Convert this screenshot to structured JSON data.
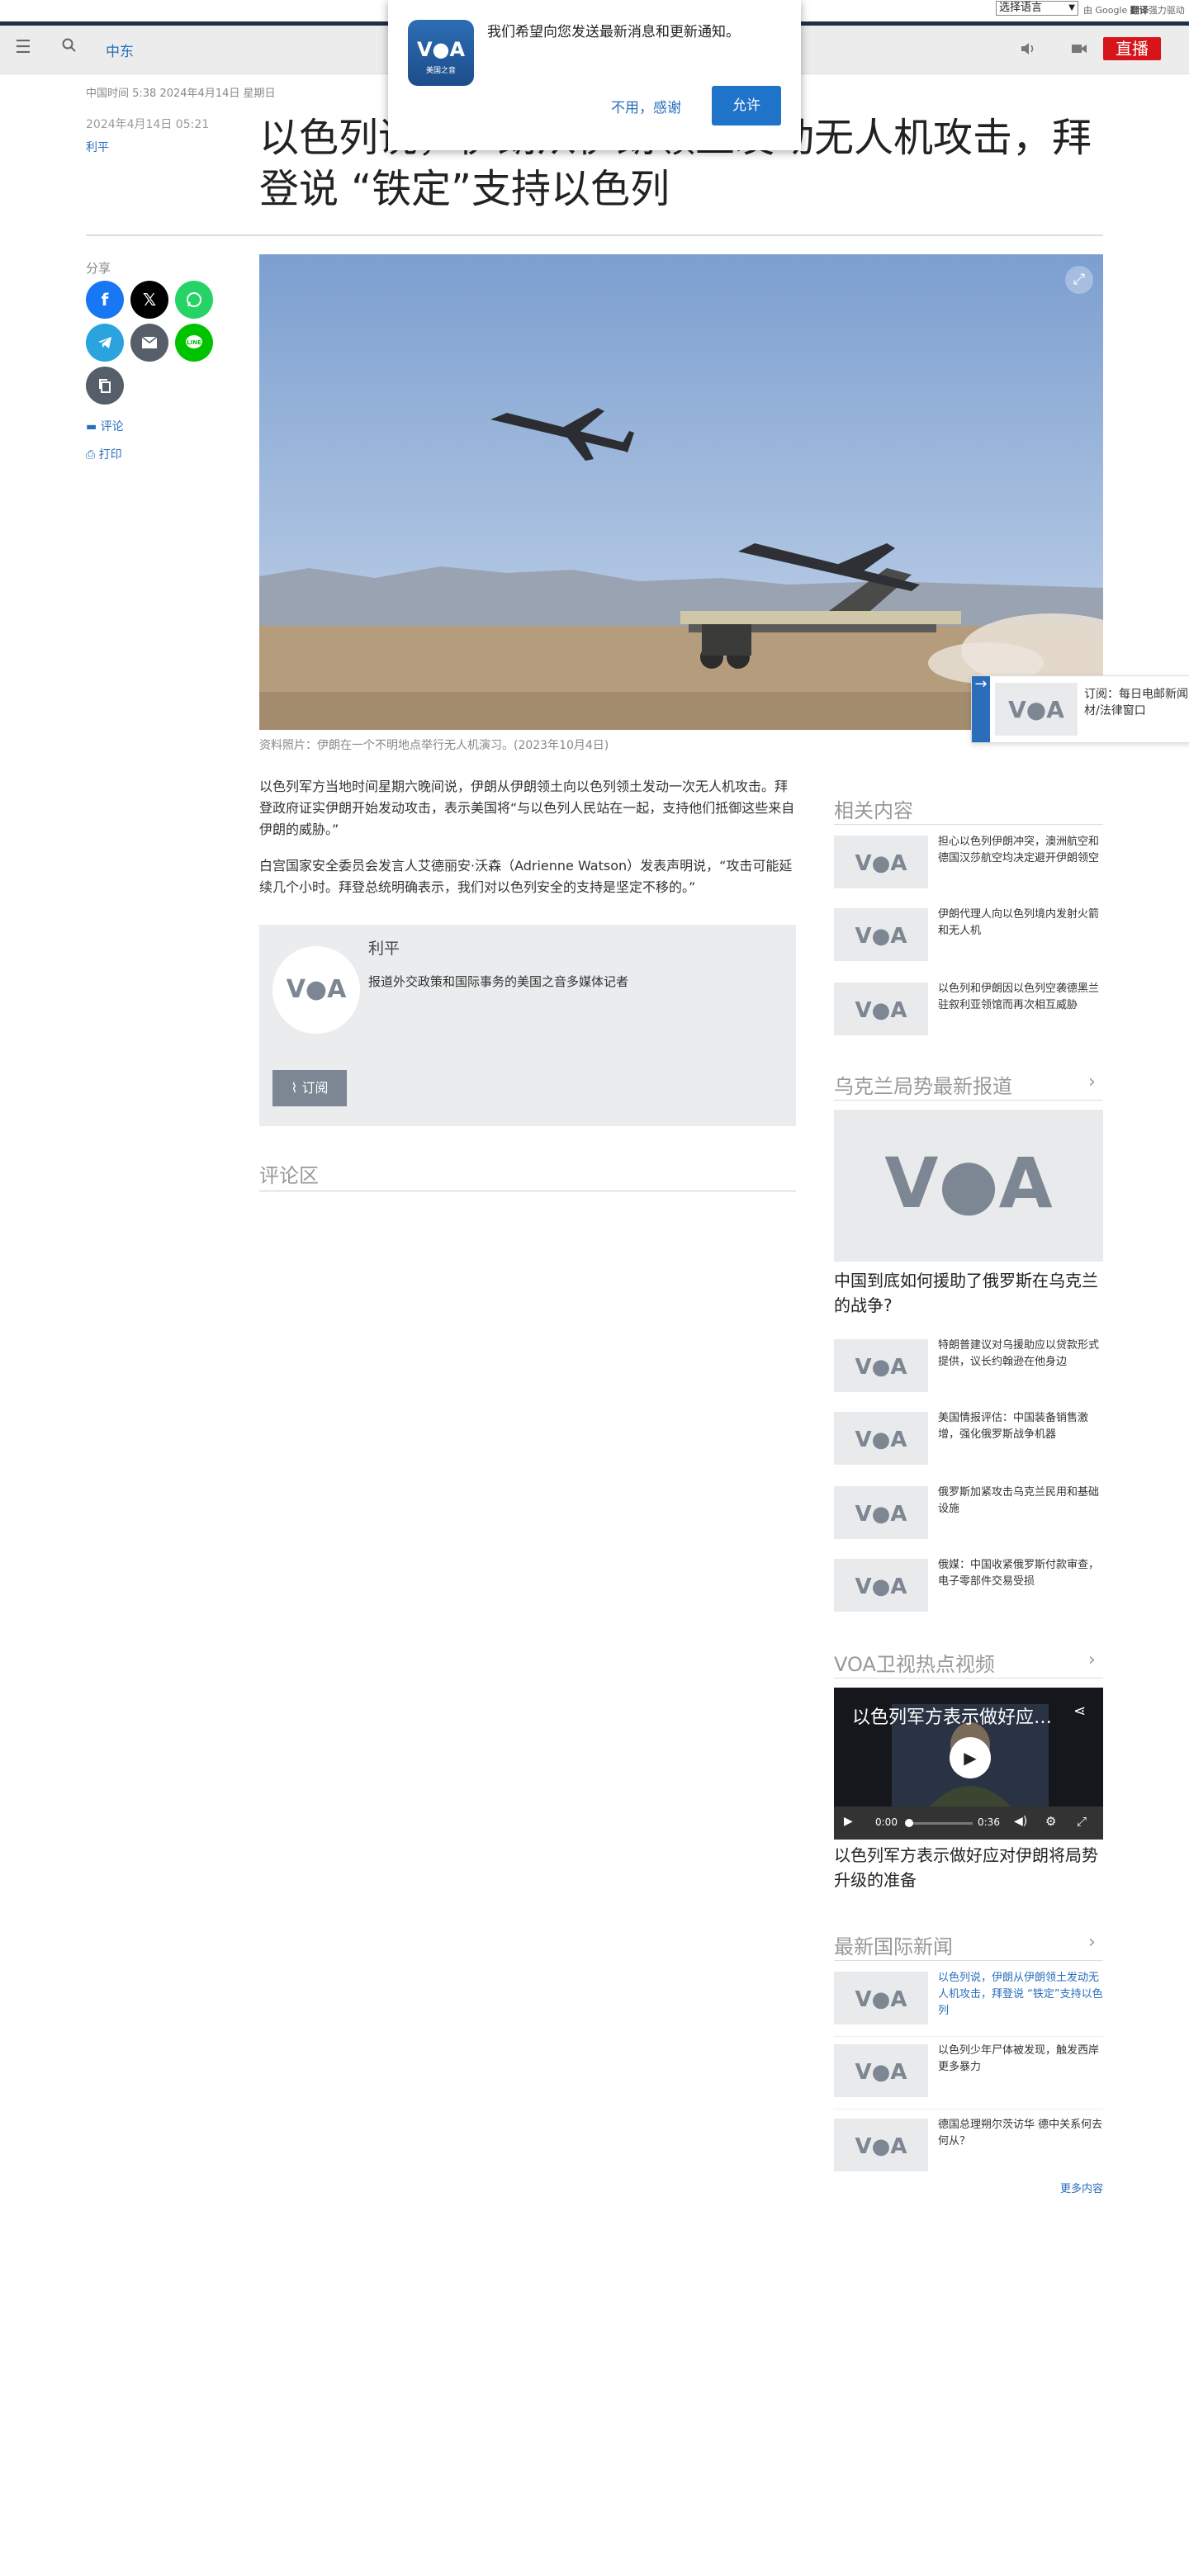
{
  "topbar": {
    "language_select": "选择语言",
    "google_prefix": "由 Google",
    "translate_label": "翻译",
    "powered": "强力驱动"
  },
  "nav": {
    "section": "中东",
    "live": "直播"
  },
  "popup": {
    "logo_caption": "美国之音",
    "message": "我们希望向您发送最新消息和更新通知。",
    "decline": "不用，感谢",
    "accept": "允许"
  },
  "article": {
    "timestamp": "中国时间 5:38 2024年4月14日 星期日",
    "date": "2024年4月14日 05:21",
    "author": "利平",
    "headline": "以色列说，伊朗从伊朗领土发动无人机攻击，拜登说 “铁定”支持以色列",
    "share_label": "分享",
    "comment_link": "评论",
    "print_link": "打印",
    "image_caption": "资料照片：伊朗在一个不明地点举行无人机演习。(2023年10月4日)",
    "paragraphs": [
      "以色列军方当地时间星期六晚间说，伊朗从伊朗领土向以色列领土发动一次无人机攻击。拜登政府证实伊朗开始发动攻击，表示美国将“与以色列人民站在一起，支持他们抵御这些来自伊朗的威胁。”",
      "白宫国家安全委员会发言人艾德丽安·沃森（Adrienne Watson）发表声明说，“攻击可能延续几个小时。拜登总统明确表示，我们对以色列安全的支持是坚定不移的。”"
    ]
  },
  "subscribe_popup": {
    "text": "订阅：每日电邮新闻材/法律窗口"
  },
  "author_box": {
    "name": "利平",
    "description": "报道外交政策和国际事务的美国之音多媒体记者",
    "subscribe": "订阅"
  },
  "comments": {
    "title": "评论区"
  },
  "related": {
    "title": "相关内容",
    "items": [
      "担心以色列伊朗冲突，澳洲航空和德国汉莎航空均决定避开伊朗领空",
      "伊朗代理人向以色列境内发射火箭和无人机",
      "以色列和伊朗因以色列空袭德黑兰驻叙利亚领馆而再次相互威胁"
    ]
  },
  "ukraine": {
    "title": "乌克兰局势最新报道",
    "lead": "中国到底如何援助了俄罗斯在乌克兰的战争?",
    "items": [
      "特朗普建议对乌援助应以贷款形式提供，议长约翰逊在他身边",
      "美国情报评估：中国装备销售激增，强化俄罗斯战争机器",
      "俄罗斯加紧攻击乌克兰民用和基础设施",
      "俄媒：中国收紧俄罗斯付款审查，电子零部件交易受损"
    ]
  },
  "video_section": {
    "title": "VOA卫视热点视频",
    "video_title": "以色列军方表示做好应对伊朗将局势升级的准备",
    "time_current": "0:00",
    "time_total": "0:36",
    "caption": "以色列军方表示做好应对伊朗将局势升级的准备"
  },
  "intl": {
    "title": "最新国际新闻",
    "items": [
      "以色列说，伊朗从伊朗领土发动无人机攻击，拜登说 “铁定”支持以色列",
      "以色列少年尸体被发现，触发西岸更多暴力",
      "德国总理朔尔茨访华 德中关系何去何从？"
    ],
    "more": "更多内容"
  },
  "colors": {
    "brand_blue": "#2a6ebb",
    "live_red": "#d7141a",
    "nav_dark": "#1f2f44",
    "placeholder_grey": "#e8eaec"
  }
}
